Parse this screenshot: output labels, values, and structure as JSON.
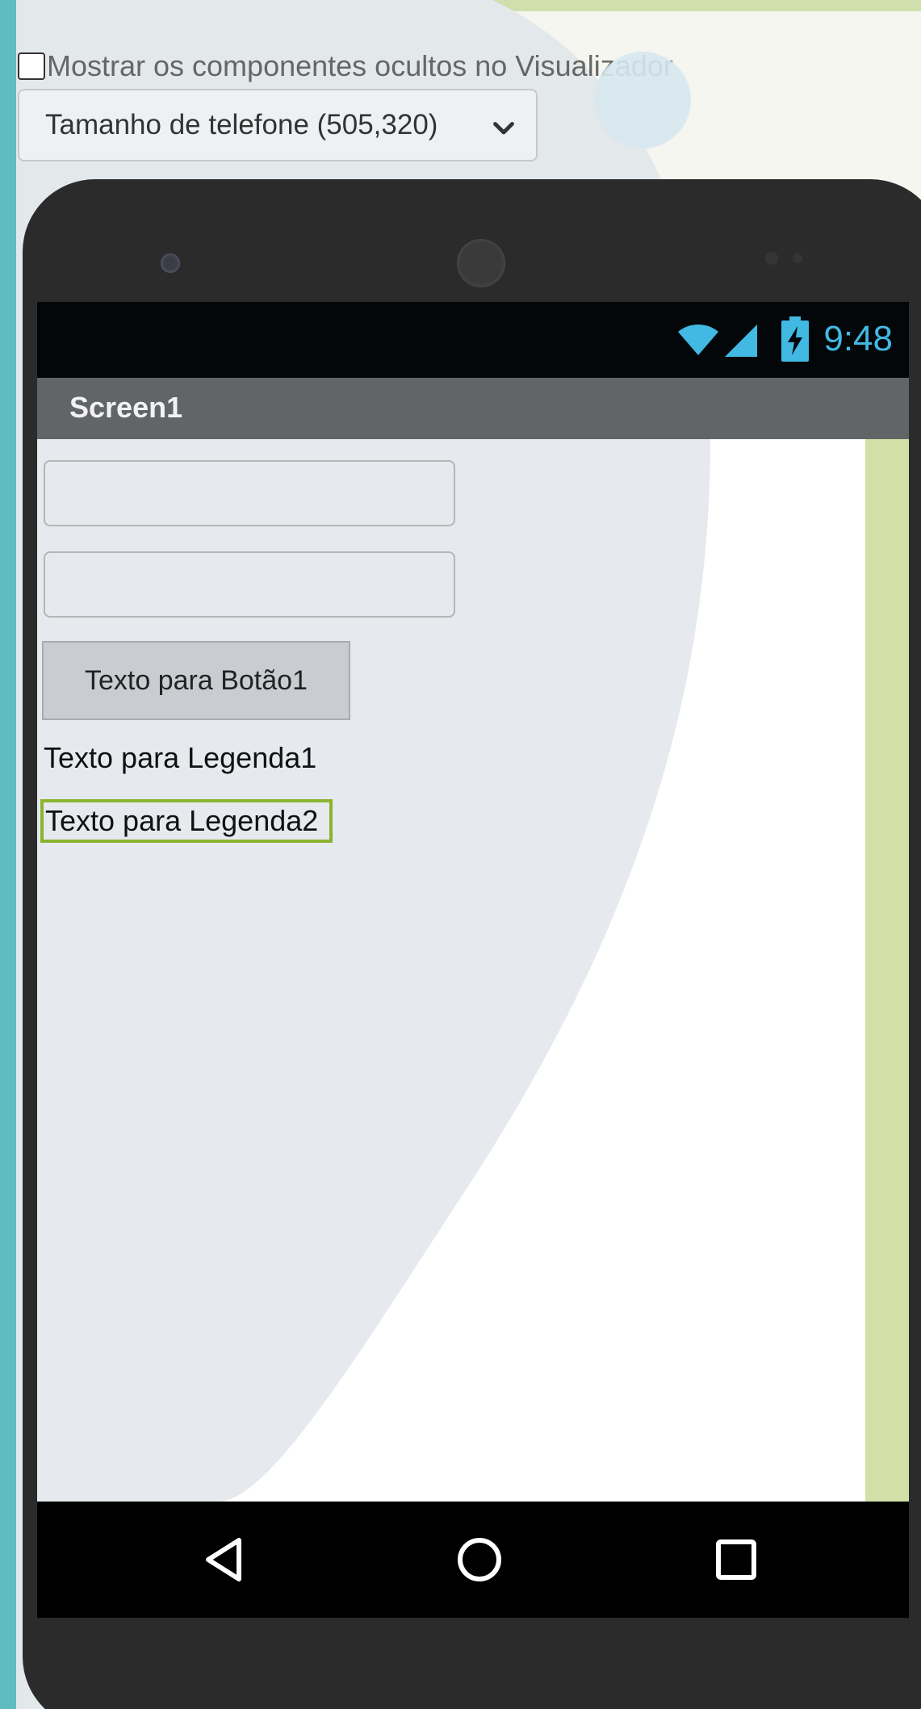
{
  "designer": {
    "show_hidden_label": "Mostrar os componentes ocultos no Visualizador",
    "show_hidden_checked": false,
    "phone_size_selected": "Tamanho de telefone (505,320)"
  },
  "device": {
    "status_time": "9:48",
    "screen_title": "Screen1"
  },
  "components": {
    "textbox1_value": "",
    "textbox2_value": "",
    "button1_label": "Texto para Botão1",
    "label1_text": "Texto para Legenda1",
    "label2_text": "Texto para Legenda2"
  },
  "colors": {
    "status_time": "#41b9e2",
    "selection_border": "#8ab32f",
    "title_bar": "#616568",
    "left_strip": "#5fbdbf",
    "right_gutter": "#d3e0a7"
  },
  "icons": {
    "status": [
      "wifi-icon",
      "signal-icon",
      "battery-charging-icon"
    ],
    "nav": [
      "back-icon",
      "home-icon",
      "recents-icon"
    ]
  }
}
